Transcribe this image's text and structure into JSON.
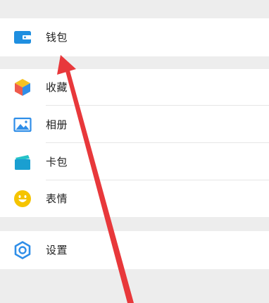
{
  "menu": {
    "wallet": {
      "label": "钱包",
      "icon": "wallet-icon",
      "color": "#1f8fe0"
    },
    "favorites": {
      "label": "收藏",
      "icon": "favorites-cube-icon"
    },
    "album": {
      "label": "相册",
      "icon": "album-image-icon",
      "color": "#2f8ee8"
    },
    "card_pack": {
      "label": "卡包",
      "icon": "card-pack-icon",
      "color": "#25c2c8"
    },
    "stickers": {
      "label": "表情",
      "icon": "smiley-face-icon",
      "color": "#f5c400"
    },
    "settings": {
      "label": "设置",
      "icon": "settings-gear-icon",
      "color": "#2f8ee8"
    }
  },
  "colors": {
    "background": "#ededed",
    "row": "#ffffff",
    "annotation_arrow": "#e8383b"
  }
}
